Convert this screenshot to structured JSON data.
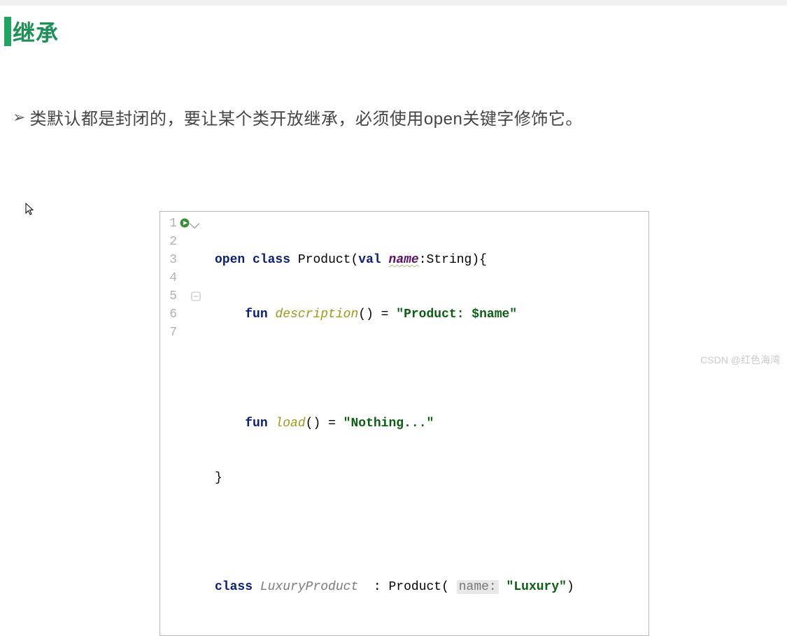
{
  "header": {
    "title": "继承"
  },
  "bullet": {
    "marker": "➢",
    "text": "类默认都是封闭的，要让某个类开放继承，必须使用open关键字修饰它。"
  },
  "code": {
    "line_numbers": [
      "1",
      "2",
      "3",
      "4",
      "5",
      "6",
      "7"
    ],
    "l1": {
      "kw_open": "open",
      "sp1": " ",
      "kw_class": "class",
      "sp2": " ",
      "cls": "Product",
      "paren_o": "(",
      "kw_val": "val",
      "sp3": " ",
      "param": "name",
      "colon_type": ":String",
      "paren_c": ")",
      "brace": "{"
    },
    "l2": {
      "indent": "    ",
      "kw_fun": "fun",
      "sp": " ",
      "fn": "description",
      "call": "()",
      " eq": " = ",
      "str": "\"Product: $name\""
    },
    "l3": {
      "blank": ""
    },
    "l4": {
      "indent": "    ",
      "kw_fun": "fun",
      "sp": " ",
      "fn": "load",
      "call": "()",
      " eq": " = ",
      "str": "\"Nothing...\""
    },
    "l5": {
      "indent": "",
      "brace": "}"
    },
    "l6": {
      "blank": ""
    },
    "l7": {
      "kw_class": "class",
      "sp": " ",
      "cls": "LuxuryProduct",
      "sp2": "  : ",
      "parent": "Product",
      "paren_o": "( ",
      "hint": "name:",
      "sp3": " ",
      "str": "\"Luxury\"",
      "paren_c": ")"
    }
  },
  "watermark": "CSDN @红色海湾"
}
